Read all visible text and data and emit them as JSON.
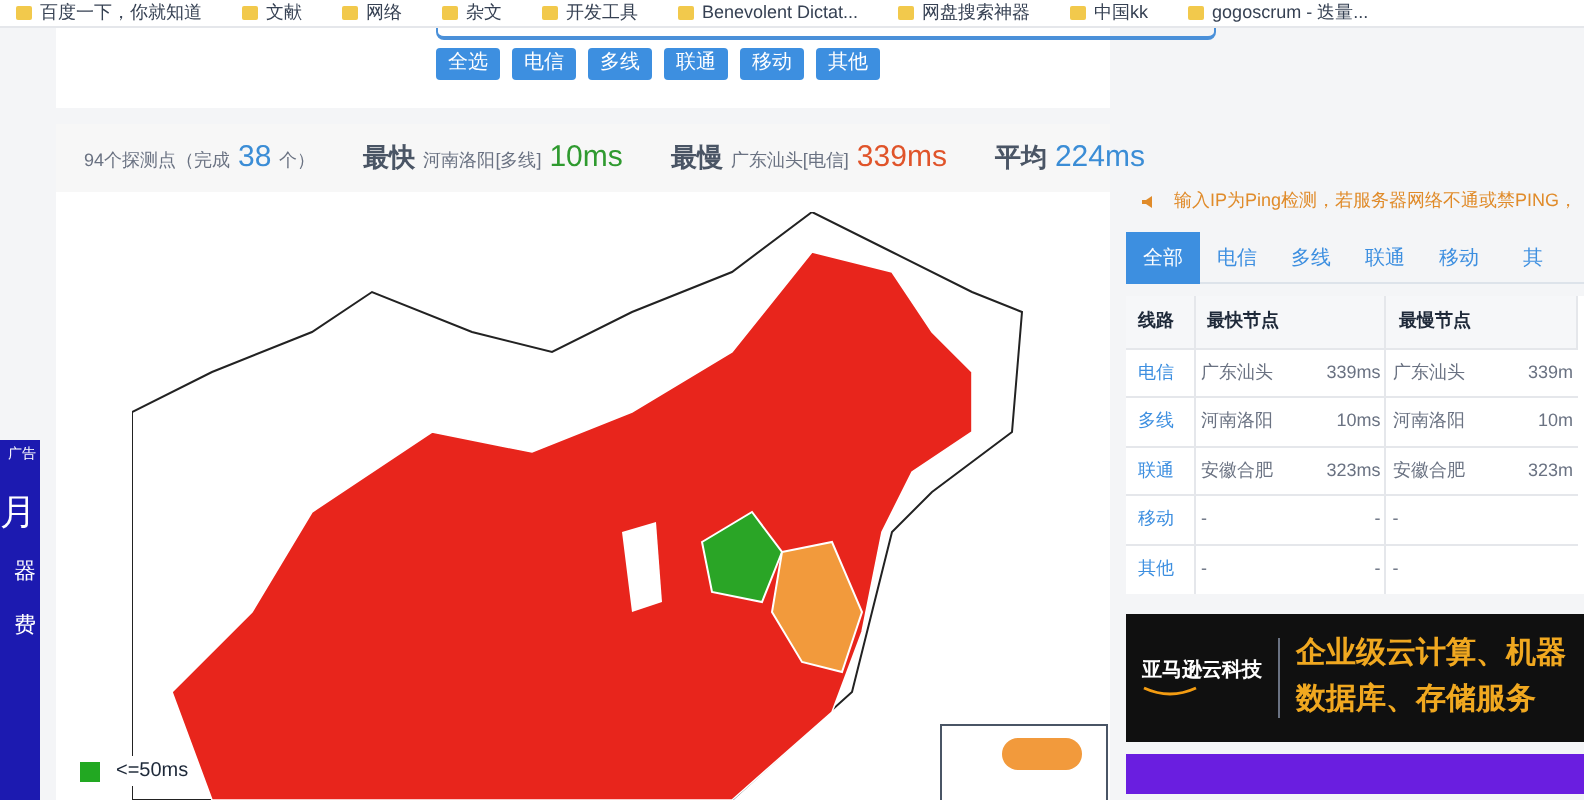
{
  "bookmarks": [
    {
      "label": "百度一下，你就知道"
    },
    {
      "label": "文献"
    },
    {
      "label": "网络"
    },
    {
      "label": "杂文"
    },
    {
      "label": "开发工具"
    },
    {
      "label": "Benevolent Dictat..."
    },
    {
      "label": "网盘搜索神器"
    },
    {
      "label": "中国kk"
    },
    {
      "label": "gogoscrum - 迭量..."
    }
  ],
  "filters": [
    "全选",
    "电信",
    "多线",
    "联通",
    "移动",
    "其他"
  ],
  "stats": {
    "probes": "94个探测点（完成",
    "done": "38",
    "done_suffix": "个）",
    "fastest": {
      "label": "最快",
      "node": "河南洛阳[多线]",
      "value": "10ms"
    },
    "slowest": {
      "label": "最慢",
      "node": "广东汕头[电信]",
      "value": "339ms"
    },
    "average": {
      "label": "平均",
      "value": "224ms"
    }
  },
  "left_ad": {
    "tag": "广告",
    "texts": [
      "月",
      "器",
      "费"
    ]
  },
  "legend": [
    {
      "color": "#22a822",
      "label": "<=50ms"
    }
  ],
  "notice": "输入IP为Ping检测，若服务器网络不通或禁PING，",
  "tabs": [
    {
      "label": "全部",
      "selected": true
    },
    {
      "label": "电信",
      "selected": false
    },
    {
      "label": "多线",
      "selected": false
    },
    {
      "label": "联通",
      "selected": false
    },
    {
      "label": "移动",
      "selected": false
    },
    {
      "label": "其",
      "selected": false
    }
  ],
  "table": {
    "columns": [
      "线路",
      "最快节点",
      "最慢节点"
    ],
    "rows": [
      {
        "line": "电信",
        "fast_node": "广东汕头",
        "fast_ms": "339ms",
        "slow_node": "广东汕头",
        "slow_ms": "339m"
      },
      {
        "line": "多线",
        "fast_node": "河南洛阳",
        "fast_ms": "10ms",
        "slow_node": "河南洛阳",
        "slow_ms": "10m"
      },
      {
        "line": "联通",
        "fast_node": "安徽合肥",
        "fast_ms": "323ms",
        "slow_node": "安徽合肥",
        "slow_ms": "323m"
      },
      {
        "line": "移动",
        "fast_node": "-",
        "fast_ms": "-",
        "slow_node": "-"
      },
      {
        "line": "其他",
        "fast_node": "-",
        "fast_ms": "-",
        "slow_node": "-"
      }
    ]
  },
  "ad": {
    "brand": "亚马逊云科技",
    "line1": "企业级云计算、机器",
    "line2": "数据库、存储服务"
  }
}
